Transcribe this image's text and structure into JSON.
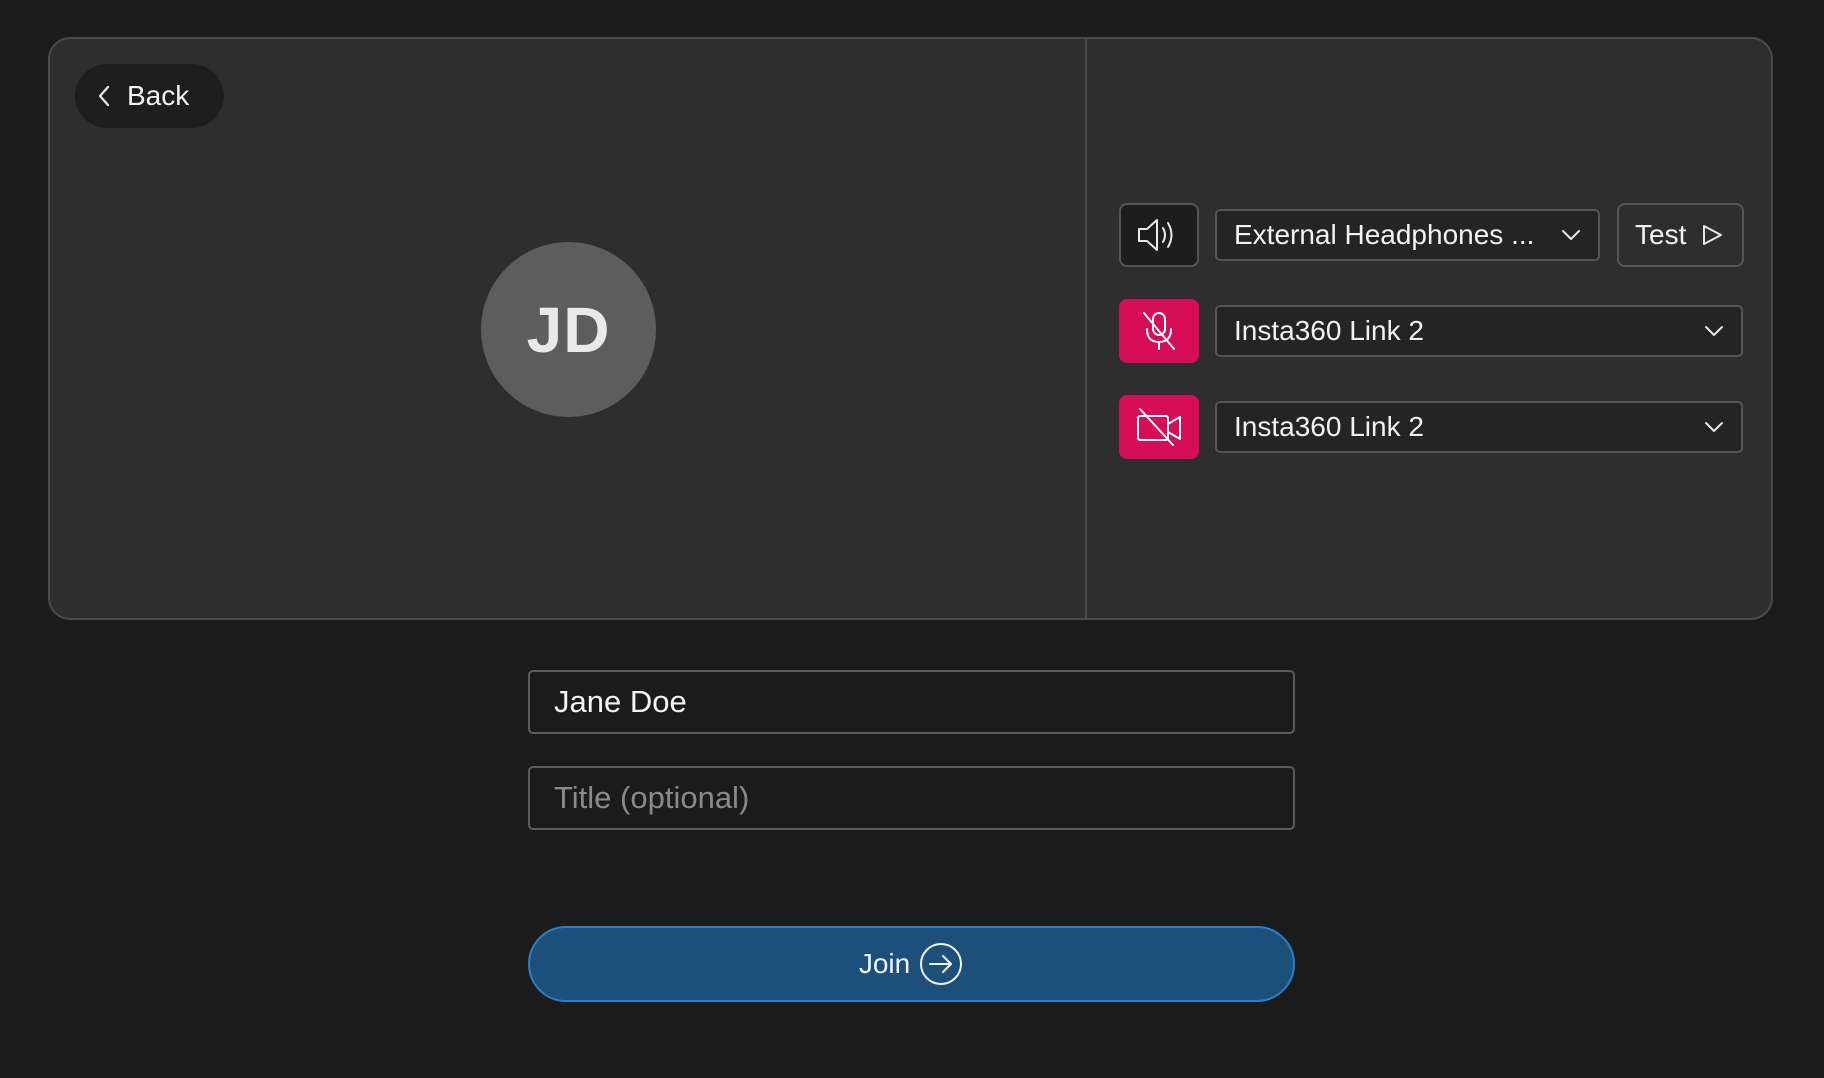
{
  "back": {
    "label": "Back"
  },
  "avatar": {
    "initials": "JD"
  },
  "devices": {
    "speaker": {
      "icon": "speaker-icon",
      "selected": "External Headphones ..."
    },
    "test": {
      "label": "Test",
      "icon": "play-icon"
    },
    "microphone": {
      "icon": "mic-off-icon",
      "selected": "Insta360 Link 2",
      "muted": true
    },
    "camera": {
      "icon": "camera-off-icon",
      "selected": "Insta360 Link 2",
      "muted": true
    }
  },
  "form": {
    "name_value": "Jane Doe",
    "title_placeholder": "Title (optional)"
  },
  "join": {
    "label": "Join",
    "icon": "arrow-right-circle-icon"
  },
  "colors": {
    "background": "#1b1b1b",
    "panel": "#2e2e2e",
    "muted_red": "#d60c58",
    "join_blue": "#1c4f7a",
    "join_border": "#2a7fc8"
  }
}
